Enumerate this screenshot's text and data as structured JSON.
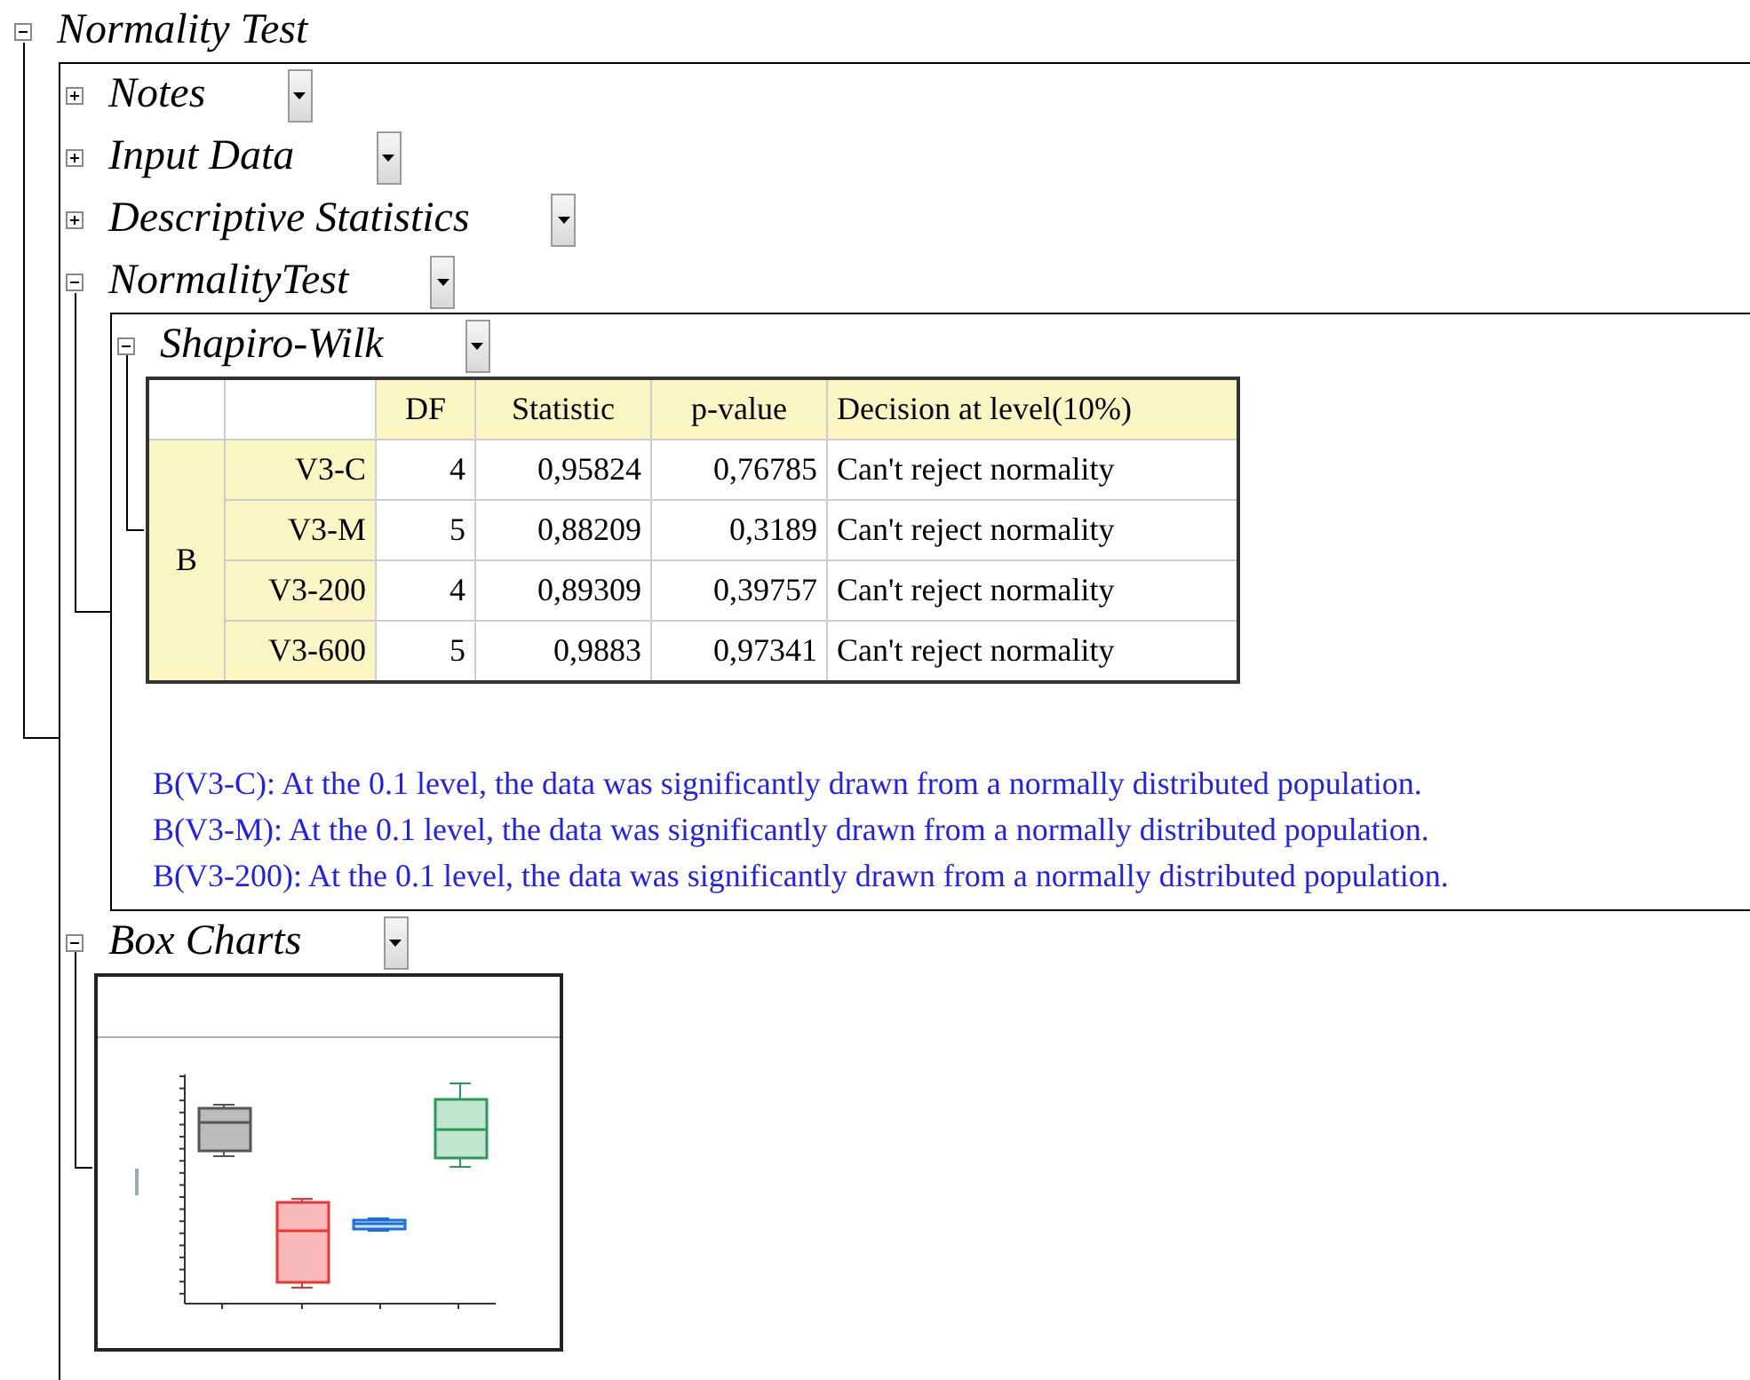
{
  "root": {
    "title": "Normality Test",
    "expanded": true,
    "kind": "section",
    "children": [
      {
        "title": "Notes",
        "expanded": false
      },
      {
        "title": "Input Data",
        "expanded": false
      },
      {
        "title": "Descriptive Statistics",
        "expanded": false
      },
      {
        "title": "NormalityTest",
        "expanded": true,
        "kind": "section",
        "children": [
          {
            "title": "Shapiro-Wilk",
            "expanded": true,
            "kind": "table",
            "table": {
              "columns": [
                "DF",
                "Statistic",
                "p-value",
                "Decision at level(10%)"
              ],
              "group": "B",
              "rows": [
                {
                  "label": "V3-C",
                  "cells": [
                    "4",
                    "0,95824",
                    "0,76785",
                    "Can't reject normality"
                  ]
                },
                {
                  "label": "V3-M",
                  "cells": [
                    "5",
                    "0,88209",
                    "0,3189",
                    "Can't reject normality"
                  ]
                },
                {
                  "label": "V3-200",
                  "cells": [
                    "4",
                    "0,89309",
                    "0,39757",
                    "Can't reject normality"
                  ]
                },
                {
                  "label": "V3-600",
                  "cells": [
                    "5",
                    "0,9883",
                    "0,97341",
                    "Can't reject normality"
                  ]
                }
              ]
            },
            "notes": [
              "B(V3-C): At the 0.1 level, the data was significantly drawn from a normally distributed population.",
              "B(V3-M): At the 0.1 level, the data was significantly drawn from a normally distributed population.",
              "B(V3-200): At the 0.1 level, the data was significantly drawn from a normally distributed population."
            ]
          }
        ]
      },
      {
        "title": "Box Charts",
        "expanded": true,
        "kind": "graph"
      }
    ]
  }
}
